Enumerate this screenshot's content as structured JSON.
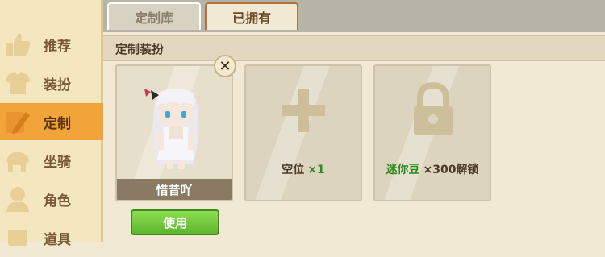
{
  "tabs": [
    {
      "label": "定制库"
    },
    {
      "label": "已拥有"
    }
  ],
  "sidebar": {
    "items": [
      {
        "label": "推荐",
        "icon": "thumbs-up-icon"
      },
      {
        "label": "装扮",
        "icon": "shirt-icon"
      },
      {
        "label": "定制",
        "icon": "pencil-icon",
        "active": true
      },
      {
        "label": "坐骑",
        "icon": "mount-icon"
      },
      {
        "label": "角色",
        "icon": "character-icon"
      },
      {
        "label": "道具",
        "icon": "prop-icon"
      }
    ]
  },
  "section": {
    "title": "定制装扮"
  },
  "cards": [
    {
      "name": "惜昔吖"
    },
    {
      "slot_label": "空位",
      "slot_count": "×1"
    },
    {
      "currency": "迷你豆",
      "amount": "×300",
      "suffix": "解锁"
    }
  ],
  "use_button": {
    "label": "使用"
  },
  "colors": {
    "active": "#f2a33a",
    "green": "#5cb52d",
    "panel": "#f1e9d4"
  }
}
